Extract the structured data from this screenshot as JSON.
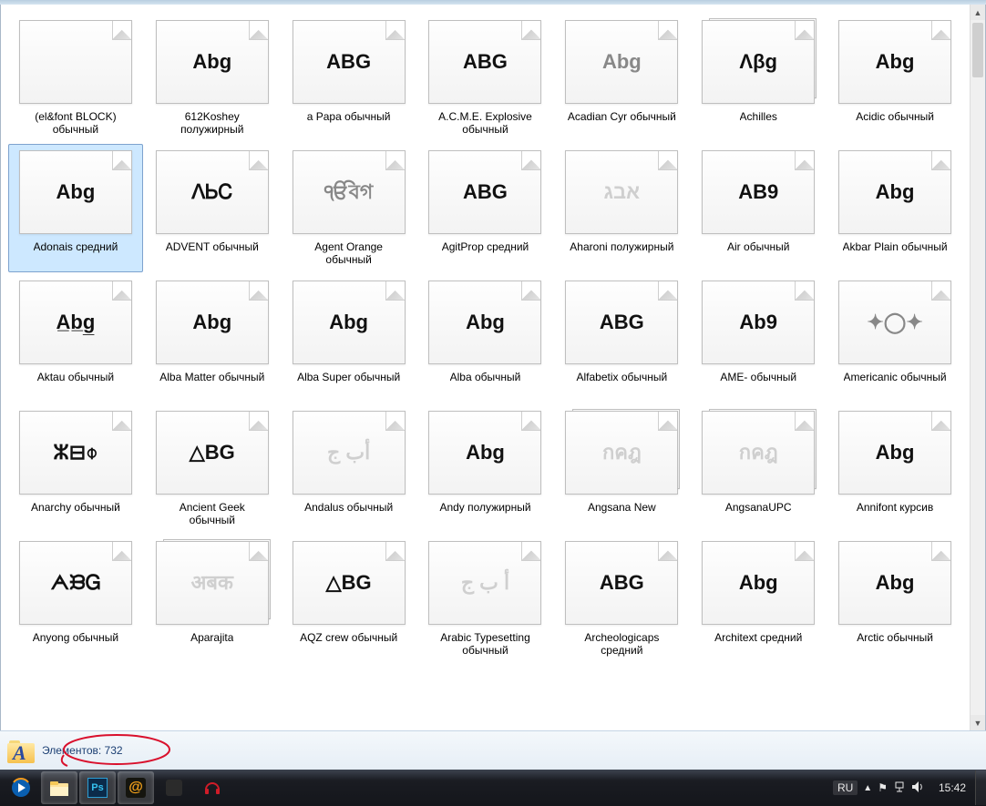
{
  "items": [
    {
      "label": "(el&font BLOCK)\nобычный",
      "preview": "",
      "stack": false,
      "cls": ""
    },
    {
      "label": "612Koshey\nполужирный",
      "preview": "Abg",
      "stack": false,
      "cls": ""
    },
    {
      "label": "a Papa обычный",
      "preview": "ABG",
      "stack": false,
      "cls": ""
    },
    {
      "label": "A.C.M.E. Explosive\nобычный",
      "preview": "ABG",
      "stack": false,
      "cls": ""
    },
    {
      "label": "Acadian Cyr обычный",
      "preview": "Abg",
      "stack": false,
      "cls": "mid"
    },
    {
      "label": "Achilles",
      "preview": "Λβg",
      "stack": true,
      "cls": ""
    },
    {
      "label": "Acidic обычный",
      "preview": "Abg",
      "stack": false,
      "cls": ""
    },
    {
      "label": "Adonais средний",
      "preview": "Abg",
      "stack": false,
      "cls": "",
      "selected": true
    },
    {
      "label": "ADVENT обычный",
      "preview": "ᐱᏏᏟ",
      "stack": false,
      "cls": ""
    },
    {
      "label": "Agent Orange\nобычный",
      "preview": "ੴবগ",
      "stack": false,
      "cls": "mid"
    },
    {
      "label": "AgitProp средний",
      "preview": "ABG",
      "stack": false,
      "cls": ""
    },
    {
      "label": "Aharoni полужирный",
      "preview": "אבג",
      "stack": false,
      "cls": "light"
    },
    {
      "label": "Air обычный",
      "preview": "AB9",
      "stack": false,
      "cls": ""
    },
    {
      "label": "Akbar Plain обычный",
      "preview": "Abg",
      "stack": false,
      "cls": ""
    },
    {
      "label": "Aktau обычный",
      "preview": "A̲b̲g̲",
      "stack": false,
      "cls": ""
    },
    {
      "label": "Alba Matter обычный",
      "preview": "Abg",
      "stack": false,
      "cls": ""
    },
    {
      "label": "Alba Super обычный",
      "preview": "Abg",
      "stack": false,
      "cls": ""
    },
    {
      "label": "Alba обычный",
      "preview": "Abg",
      "stack": false,
      "cls": ""
    },
    {
      "label": "Alfabetix обычный",
      "preview": "ABG",
      "stack": false,
      "cls": ""
    },
    {
      "label": "AME- обычный",
      "preview": "Ab9",
      "stack": false,
      "cls": ""
    },
    {
      "label": "Americanic обычный",
      "preview": "✦◯✦",
      "stack": false,
      "cls": "mid"
    },
    {
      "label": "Anarchy обычный",
      "preview": "ⵣ⊟⌽",
      "stack": false,
      "cls": ""
    },
    {
      "label": "Ancient Geek\nобычный",
      "preview": "△BG",
      "stack": false,
      "cls": ""
    },
    {
      "label": "Andalus обычный",
      "preview": "أب ج",
      "stack": false,
      "cls": "light"
    },
    {
      "label": "Andy полужирный",
      "preview": "Abg",
      "stack": false,
      "cls": ""
    },
    {
      "label": "Angsana New",
      "preview": "กคฎ",
      "stack": true,
      "cls": "light"
    },
    {
      "label": "AngsanaUPC",
      "preview": "กคฎ",
      "stack": true,
      "cls": "light"
    },
    {
      "label": "Annifont курсив",
      "preview": "Abg",
      "stack": false,
      "cls": ""
    },
    {
      "label": "Anyong обычный",
      "preview": "ᗅᙖᏀ",
      "stack": false,
      "cls": ""
    },
    {
      "label": "Aparajita",
      "preview": "अबक",
      "stack": true,
      "cls": "light"
    },
    {
      "label": "AQZ crew обычный",
      "preview": "△BG",
      "stack": false,
      "cls": ""
    },
    {
      "label": "Arabic Typesetting\nобычный",
      "preview": "أ ب ج",
      "stack": false,
      "cls": "light"
    },
    {
      "label": "Archeologicaps\nсредний",
      "preview": "ABG",
      "stack": false,
      "cls": ""
    },
    {
      "label": "Architext средний",
      "preview": "Abg",
      "stack": false,
      "cls": ""
    },
    {
      "label": "Arctic обычный",
      "preview": "Abg",
      "stack": false,
      "cls": ""
    }
  ],
  "details": {
    "count_label": "Элементов: 732"
  },
  "taskbar": {
    "lang": "RU",
    "clock": "15:42",
    "icons": [
      "wmp",
      "explorer",
      "photoshop",
      "mailru",
      "opera-like",
      "headset"
    ]
  }
}
